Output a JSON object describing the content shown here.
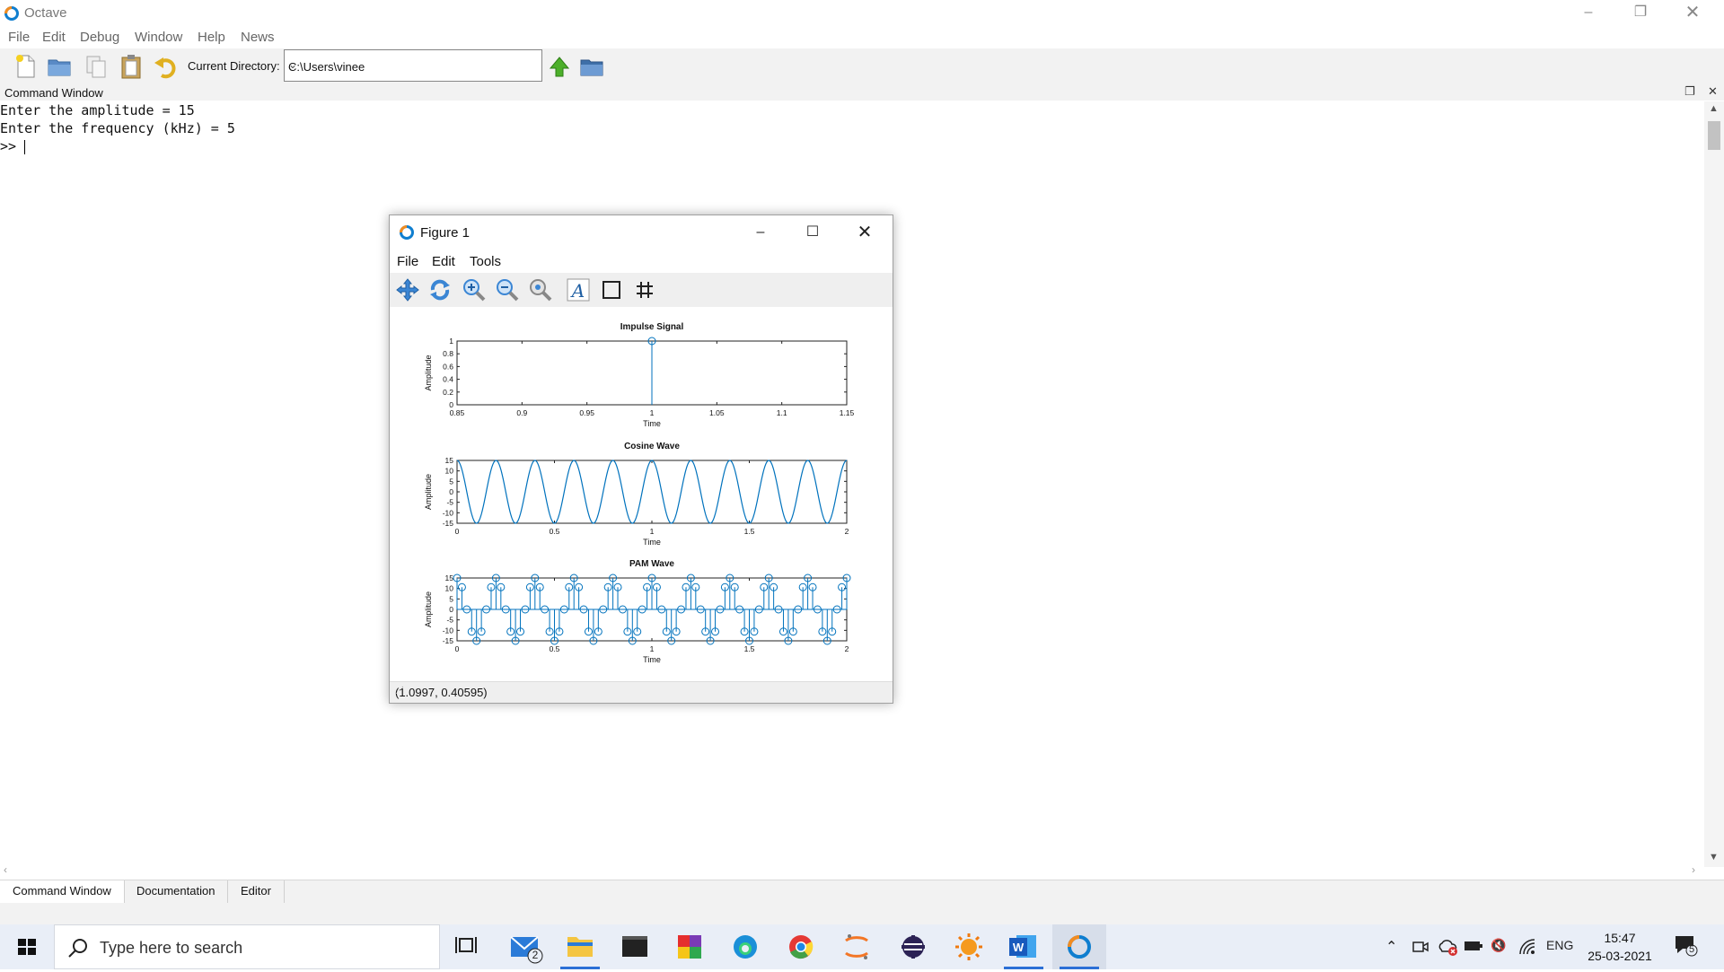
{
  "app": {
    "title": "Octave",
    "menu": [
      "File",
      "Edit",
      "Debug",
      "Window",
      "Help",
      "News"
    ],
    "current_directory_label": "Current Directory:",
    "current_directory": "C:\\Users\\vinee",
    "command_window_label": "Command Window",
    "console_lines": [
      "Enter the amplitude = 15",
      "Enter the frequency (kHz) = 5",
      ">> "
    ],
    "bottom_tabs": [
      "Command Window",
      "Documentation",
      "Editor"
    ]
  },
  "figure": {
    "title": "Figure 1",
    "menu": [
      "File",
      "Edit",
      "Tools"
    ],
    "status_coords": "(1.0997, 0.40595)",
    "plot_color": "#0072BD"
  },
  "chart_data": [
    {
      "type": "stem",
      "title": "Impulse Signal",
      "xlabel": "Time",
      "ylabel": "Amplitude",
      "xlim": [
        0.85,
        1.15
      ],
      "ylim": [
        0,
        1
      ],
      "xticks": [
        "0.85",
        "0.9",
        "0.95",
        "1",
        "1.05",
        "1.1",
        "1.15"
      ],
      "yticks": [
        "0",
        "0.2",
        "0.4",
        "0.6",
        "0.8",
        "1"
      ],
      "x": [
        1
      ],
      "y": [
        1
      ]
    },
    {
      "type": "line",
      "title": "Cosine Wave",
      "xlabel": "Time",
      "ylabel": "Amplitude",
      "xlim": [
        0,
        2
      ],
      "ylim": [
        -15,
        15
      ],
      "xticks": [
        "0",
        "0.5",
        "1",
        "1.5",
        "2"
      ],
      "yticks": [
        "-15",
        "-10",
        "-5",
        "0",
        "5",
        "10",
        "15"
      ],
      "amplitude": 15,
      "cycles": 10
    },
    {
      "type": "stem",
      "title": "PAM Wave",
      "xlabel": "Time",
      "ylabel": "Amplitude",
      "xlim": [
        0,
        2
      ],
      "ylim": [
        -15,
        15
      ],
      "xticks": [
        "0",
        "0.5",
        "1",
        "1.5",
        "2"
      ],
      "yticks": [
        "-15",
        "-10",
        "-5",
        "0",
        "5",
        "10",
        "15"
      ],
      "amplitude": 15,
      "cycles": 10,
      "samples_per_cycle": 8
    }
  ],
  "taskbar": {
    "search_placeholder": "Type here to search",
    "mail_badge": "2",
    "language": "ENG",
    "time": "15:47",
    "date": "25-03-2021",
    "notification_count": "5"
  }
}
